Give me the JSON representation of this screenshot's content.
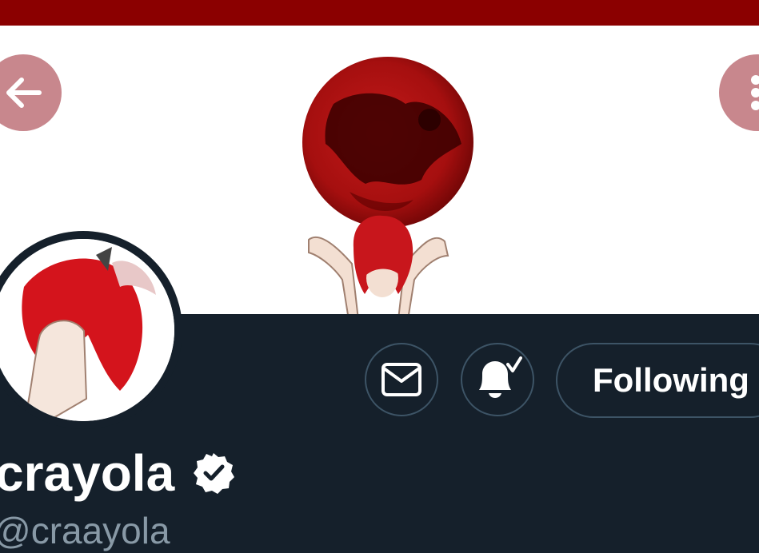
{
  "header": {
    "back_icon": "arrow-left-icon",
    "more_icon": "more-vertical-icon"
  },
  "actions": {
    "message_icon": "mail-icon",
    "notify_icon": "bell-check-icon",
    "following_label": "Following"
  },
  "profile": {
    "display_name": "crayola",
    "verified_icon": "verified-badge-icon",
    "handle": "@craayola"
  },
  "colors": {
    "top_bar": "#8b0000",
    "background": "#15202b",
    "border": "#3d5466"
  }
}
